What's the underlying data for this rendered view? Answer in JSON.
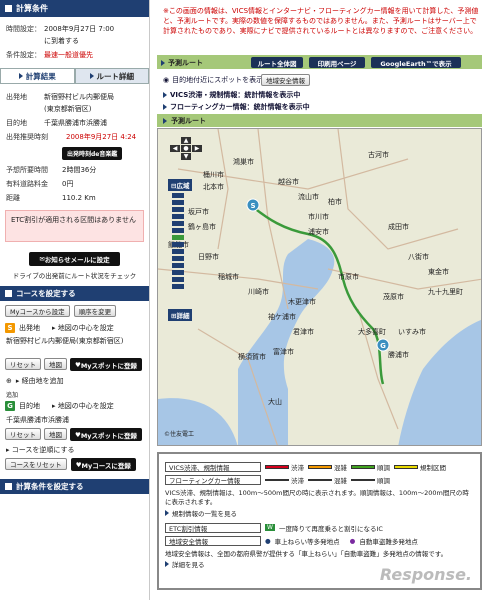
{
  "calc_conditions": {
    "header": "計算条件",
    "time_label": "時間設定：",
    "time_value": "2008年9月27日 7:00",
    "time_value2": "に到着する",
    "cond_label": "条件設定：",
    "cond_value": "最速一般道優先"
  },
  "tabs": [
    {
      "label": "計算結果"
    },
    {
      "label": "ルート詳細"
    }
  ],
  "result": {
    "origin_label": "出発地",
    "origin_value": "新宿野村ビル内郵便局",
    "origin_value2": "(東京都新宿区)",
    "dest_label": "目的地",
    "dest_value": "千葉県勝浦市浜勝浦",
    "depart_label": "出発推奨時刻",
    "depart_value": "2008年9月27日 4:24",
    "depart_button": "出発時刻de音楽鑑",
    "time_label": "予想所要時間",
    "time_value": "2時間36分",
    "toll_label": "有料道路料金",
    "toll_value": "0円",
    "dist_label": "距離",
    "dist_value": "110.2 Km",
    "etc_note": "ETC割引が適用される区間はありません"
  },
  "mail_button": "お知らせメールに設定",
  "mail_note": "ドライブの出発前にルート状況をチェック",
  "course": {
    "header": "コースを設定する",
    "mycourse_button": "Myコースから設定",
    "order_button": "順序を変更",
    "origin_label": "出発地",
    "origin_link": "地図の中心を設定",
    "origin_value": "新宿野村ビル内郵便局(東京都新宿区)",
    "reset": "リセット",
    "map": "地図",
    "myspot": "Myスポットに登録",
    "add_label": "追加",
    "via_link": "経由地を追加",
    "dest_label": "目的地",
    "dest_link": "地図の中心を設定",
    "dest_value": "千葉県勝浦市浜勝浦",
    "reverse_link": "コースを逆順にする",
    "reset_course": "コースをリセット",
    "mycourse_register": "Myコースに登録"
  },
  "calc_set_header": "計算条件を設定する",
  "top_note": "※この画面の情報は、VICS情報とインターナビ・フローティングカー情報を用いて計算した、予測値と、予測ルートです。実際の数値を保障するものではありません。また、予測ルートはサーバー上で計算されたものであり、実際にナビで提供されているルートとは異なりますので、ご注意ください。",
  "toolbar": {
    "section": "予測ルート",
    "route_all": "ルート全体図",
    "print": "印刷用ページ",
    "google": "GoogleEarth™で表示"
  },
  "links": {
    "spot": "目的地付近にスポットを表示",
    "safety": "地域安全情報",
    "vics": "VICS渋滞・規制情報：統計情報を表示中",
    "floating": "フローティングカー情報：統計情報を表示中"
  },
  "map_labels": {
    "wide": "広域",
    "detail": "詳細",
    "copyright": "©住友電工",
    "origin_marker": "S",
    "dest_marker": "G",
    "places": [
      "古河市",
      "桶川市",
      "北本市",
      "鴻巣市",
      "坂戸市",
      "越谷市",
      "鶴ヶ島市",
      "飯能市",
      "流山市",
      "柏市",
      "市川市",
      "浦安市",
      "日野市",
      "稲城市",
      "川崎市",
      "成田市",
      "八街市",
      "東金市",
      "九十九里町",
      "市原市",
      "茂原市",
      "木更津市",
      "袖ケ浦市",
      "君津市",
      "富津市",
      "横須賀市",
      "いすみ市",
      "大多喜町",
      "勝浦市",
      "大山"
    ]
  },
  "legend": {
    "vics_label": "VICS渋滞、規制情報",
    "jam": "渋滞",
    "congest": "混雑",
    "smooth": "順調",
    "restrict": "規制区間",
    "fc_label": "フローティングカー情報",
    "fc_jam": "渋滞",
    "fc_congest": "混雑",
    "fc_smooth": "順調",
    "note1": "VICS渋滞、規制情報は、100m〜500m間尺の時に表示されます。順調情報は、100m〜200m間尺の時に表示されます。",
    "list_link": "規制情報の一覧を見る",
    "etc_label": "ETC割引情報",
    "etc_desc": "一度降りて再度乗ると割引になるIC",
    "safety_label": "地域安全情報",
    "safety_a": "車上ねらい等多発地点",
    "safety_b": "自動車盗難多発地点",
    "note2": "地域安全情報は、全国の都府県警が提供する「車上ねらい」「自動車盗難」多発地点の情報です。",
    "detail_link": "詳細を見る",
    "watermark": "Response."
  },
  "colors": {
    "navy": "#1f3f72",
    "green_bar": "#a5c879",
    "route": "#3a9a3a",
    "jam": "#d6001c",
    "congest": "#f39800",
    "smooth": "#41a31f",
    "restrict": "#e8d900"
  }
}
